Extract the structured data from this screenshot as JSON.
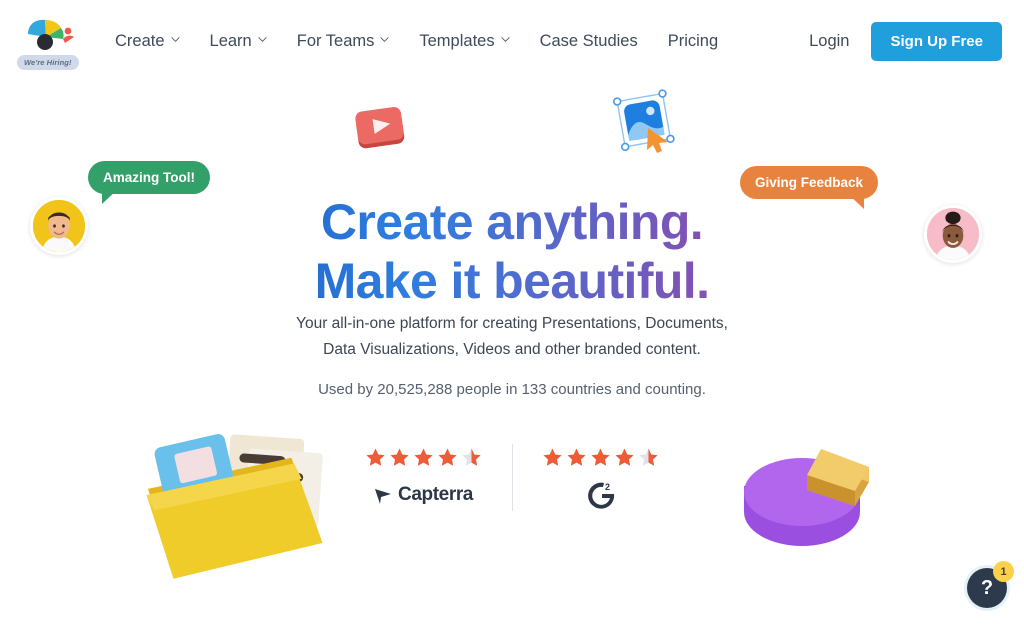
{
  "header": {
    "logo_name": "visme-logo",
    "hiring_badge": "We're Hiring!",
    "nav": [
      {
        "label": "Create",
        "has_dropdown": true
      },
      {
        "label": "Learn",
        "has_dropdown": true
      },
      {
        "label": "For Teams",
        "has_dropdown": true
      },
      {
        "label": "Templates",
        "has_dropdown": true
      },
      {
        "label": "Case Studies",
        "has_dropdown": false
      },
      {
        "label": "Pricing",
        "has_dropdown": false
      }
    ],
    "login_label": "Login",
    "signup_label": "Sign Up Free",
    "signup_color": "#1f9fdb"
  },
  "hero": {
    "headline_line1": "Create anything.",
    "headline_line2": "Make it beautiful.",
    "headline_gradient_start": "#1b3f9e",
    "headline_gradient_end": "#d8346f",
    "subtitle_line1": "Your all-in-one platform for creating Presentations, Documents,",
    "subtitle_line2": "Data Visualizations, Videos and other branded content.",
    "used_by": "Used by 20,525,288 people in 133 countries and counting."
  },
  "testimonials": [
    {
      "text": "Amazing Tool!",
      "color": "#33a06a",
      "avatar_bg": "#f2c319",
      "side": "left"
    },
    {
      "text": "Giving Feedback",
      "color": "#e8833f",
      "avatar_bg": "#f7bcc8",
      "side": "right"
    }
  ],
  "ratings": [
    {
      "brand": "Capterra",
      "stars_full": 4,
      "stars_half": 1,
      "rating": 4.5,
      "star_color": "#ef5a37"
    },
    {
      "brand": "G2",
      "stars_full": 4,
      "stars_half": 1,
      "rating": 4.5,
      "star_color": "#ef5a37"
    }
  ],
  "decor": {
    "play_card": "play-video-card-3d",
    "image_icon": "image-select-cursor-icon",
    "folder": "folder-documents-3d",
    "pie": "pie-chart-3d"
  },
  "help": {
    "icon": "question-mark-icon",
    "badge_count": "1",
    "symbol": "?"
  }
}
